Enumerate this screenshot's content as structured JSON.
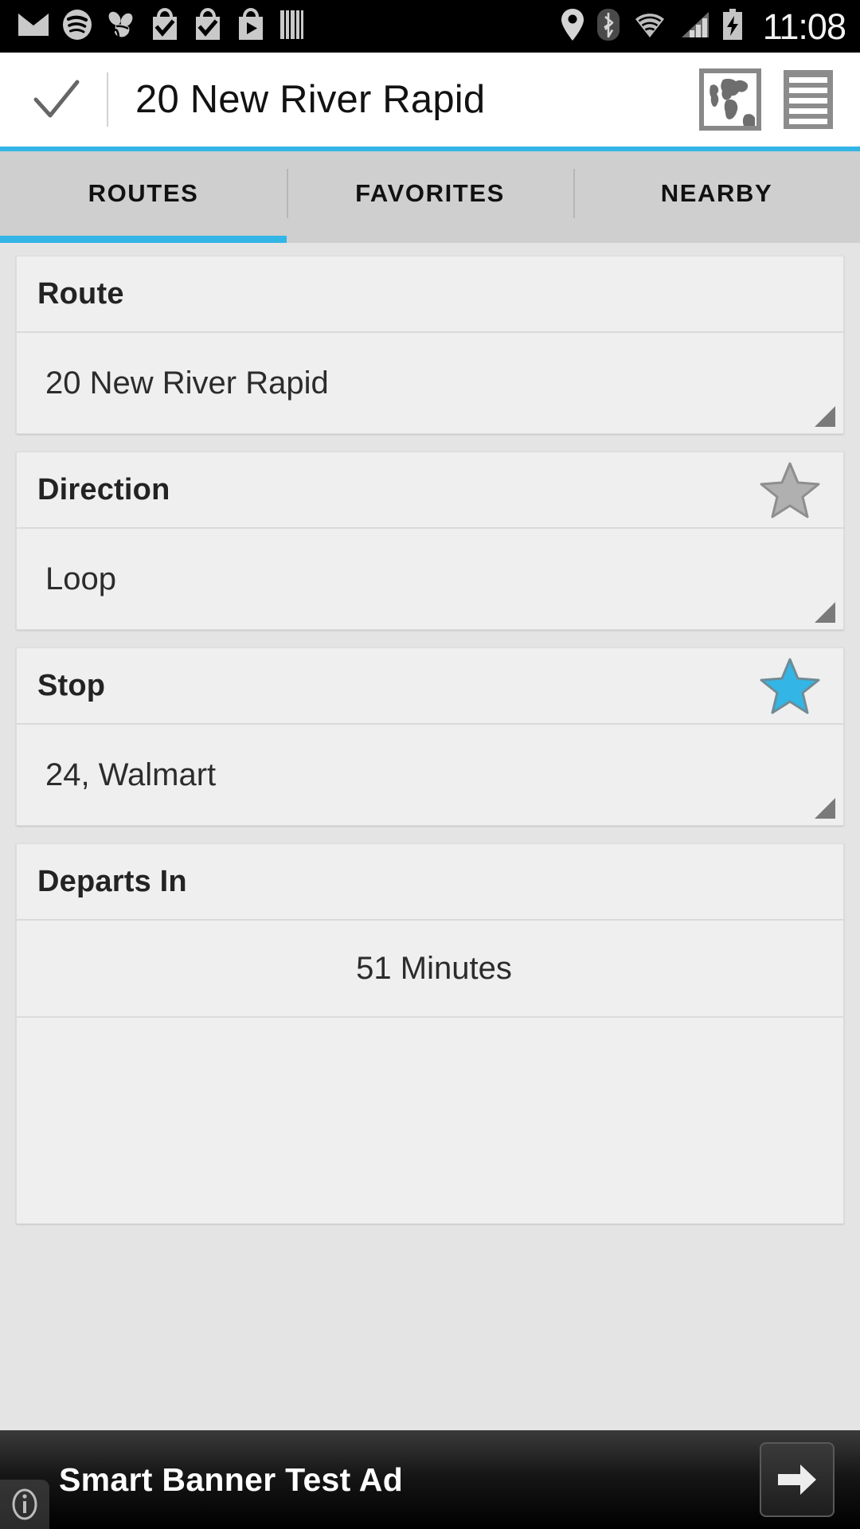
{
  "statusbar": {
    "time": "11:08",
    "left_icons": [
      {
        "name": "email-icon"
      },
      {
        "name": "spotify-icon"
      },
      {
        "name": "swarm-icon"
      },
      {
        "name": "shopping-bag-check-icon"
      },
      {
        "name": "shopping-bag-check-icon-2"
      },
      {
        "name": "play-store-icon"
      },
      {
        "name": "barcode-icon"
      }
    ],
    "right_icons": [
      {
        "name": "location-pin-icon"
      },
      {
        "name": "bluetooth-icon"
      },
      {
        "name": "wifi-icon"
      },
      {
        "name": "cellular-signal-icon"
      },
      {
        "name": "battery-charging-icon"
      }
    ]
  },
  "appbar": {
    "check_icon": "check-icon",
    "title": "20 New River Rapid",
    "map_icon": "world-map-icon",
    "list_icon": "list-icon"
  },
  "tabs": {
    "items": [
      {
        "label": "ROUTES",
        "active": true
      },
      {
        "label": "FAVORITES",
        "active": false
      },
      {
        "label": "NEARBY",
        "active": false
      }
    ],
    "active_index": 0,
    "indicator_color": "#33b5e5"
  },
  "cards": {
    "route": {
      "header": "Route",
      "value": "20 New River Rapid"
    },
    "direction": {
      "header": "Direction",
      "value": "Loop",
      "star_state": "unfilled",
      "star_color": "#b0b0b0"
    },
    "stop": {
      "header": "Stop",
      "value": "24, Walmart",
      "star_state": "filled",
      "star_color": "#33b5e5"
    },
    "departs": {
      "header": "Departs In",
      "value": "51 Minutes"
    }
  },
  "ad": {
    "text": "Smart Banner Test Ad",
    "arrow_icon": "arrow-right-icon",
    "info_icon": "info-icon"
  },
  "colors": {
    "accent": "#33b5e5",
    "tabbar_bg": "#cfcfcf",
    "card_bg": "#efefef",
    "page_bg": "#e4e4e4"
  }
}
